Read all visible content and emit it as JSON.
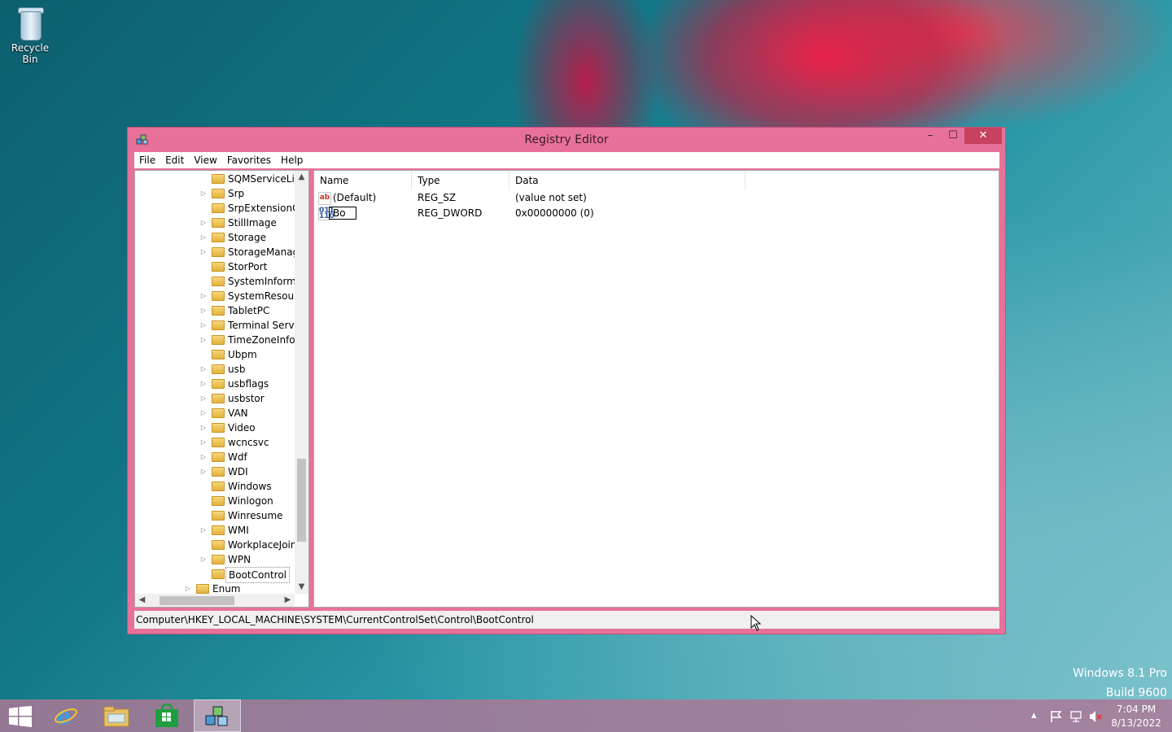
{
  "desktop": {
    "recycle_bin_label": "Recycle Bin"
  },
  "window": {
    "title": "Registry Editor",
    "buttons": {
      "minimize": "–",
      "maximize": "☐",
      "close": "✕"
    }
  },
  "menu": [
    "File",
    "Edit",
    "View",
    "Favorites",
    "Help"
  ],
  "tree": {
    "items": [
      {
        "label": "SQMServiceList",
        "expandable": false
      },
      {
        "label": "Srp",
        "expandable": true
      },
      {
        "label": "SrpExtensionCo",
        "expandable": false
      },
      {
        "label": "StillImage",
        "expandable": true
      },
      {
        "label": "Storage",
        "expandable": true
      },
      {
        "label": "StorageManage",
        "expandable": true
      },
      {
        "label": "StorPort",
        "expandable": false
      },
      {
        "label": "SystemInformat",
        "expandable": false
      },
      {
        "label": "SystemResource",
        "expandable": true
      },
      {
        "label": "TabletPC",
        "expandable": true
      },
      {
        "label": "Terminal Server",
        "expandable": true
      },
      {
        "label": "TimeZoneInforr",
        "expandable": true
      },
      {
        "label": "Ubpm",
        "expandable": false
      },
      {
        "label": "usb",
        "expandable": true
      },
      {
        "label": "usbflags",
        "expandable": true
      },
      {
        "label": "usbstor",
        "expandable": true
      },
      {
        "label": "VAN",
        "expandable": true
      },
      {
        "label": "Video",
        "expandable": true
      },
      {
        "label": "wcncsvc",
        "expandable": true
      },
      {
        "label": "Wdf",
        "expandable": true
      },
      {
        "label": "WDI",
        "expandable": true
      },
      {
        "label": "Windows",
        "expandable": false
      },
      {
        "label": "Winlogon",
        "expandable": false
      },
      {
        "label": "Winresume",
        "expandable": false
      },
      {
        "label": "WMI",
        "expandable": true
      },
      {
        "label": "WorkplaceJoin",
        "expandable": false
      },
      {
        "label": "WPN",
        "expandable": true
      },
      {
        "label": "BootControl",
        "expandable": false,
        "selected": true
      }
    ],
    "parent_item": {
      "label": "Enum",
      "expandable": true
    }
  },
  "list": {
    "columns": [
      "Name",
      "Type",
      "Data"
    ],
    "rows": [
      {
        "icon": "string-value-icon",
        "icon_text": "ab",
        "name": "(Default)",
        "type": "REG_SZ",
        "data": "(value not set)"
      },
      {
        "icon": "dword-value-icon",
        "icon_text": "011 110",
        "name": "Bo",
        "type": "REG_DWORD",
        "data": "0x00000000 (0)",
        "editing": true
      }
    ]
  },
  "status": "Computer\\HKEY_LOCAL_MACHINE\\SYSTEM\\CurrentControlSet\\Control\\BootControl",
  "watermark": {
    "line1": "Windows 8.1 Pro",
    "line2": "Build 9600"
  },
  "clock": {
    "time": "7:04 PM",
    "date": "8/13/2022"
  },
  "taskbar": [
    "start-button",
    "internet-explorer",
    "file-explorer",
    "store",
    "registry-editor"
  ]
}
